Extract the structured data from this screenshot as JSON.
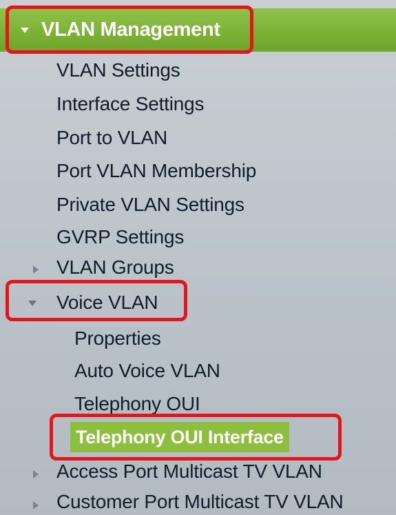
{
  "menu": {
    "header": "VLAN Management",
    "items": [
      {
        "label": "VLAN Settings"
      },
      {
        "label": "Interface Settings"
      },
      {
        "label": "Port to VLAN"
      },
      {
        "label": "Port VLAN Membership"
      },
      {
        "label": "Private VLAN Settings"
      },
      {
        "label": "GVRP Settings"
      },
      {
        "label": "VLAN Groups"
      },
      {
        "label": "Voice VLAN"
      }
    ],
    "voice_vlan_children": [
      {
        "label": "Properties"
      },
      {
        "label": "Auto Voice VLAN"
      },
      {
        "label": "Telephony OUI"
      },
      {
        "label": "Telephony OUI Interface"
      }
    ],
    "bottom_items": [
      {
        "label": "Access Port Multicast TV VLAN"
      },
      {
        "label": "Customer Port Multicast TV VLAN"
      }
    ]
  },
  "colors": {
    "header_green": "#7cb336",
    "selected_green": "#8cbf3c",
    "highlight_red": "#e8141b",
    "text": "#0f1c2a",
    "background": "#bfc7cd"
  }
}
